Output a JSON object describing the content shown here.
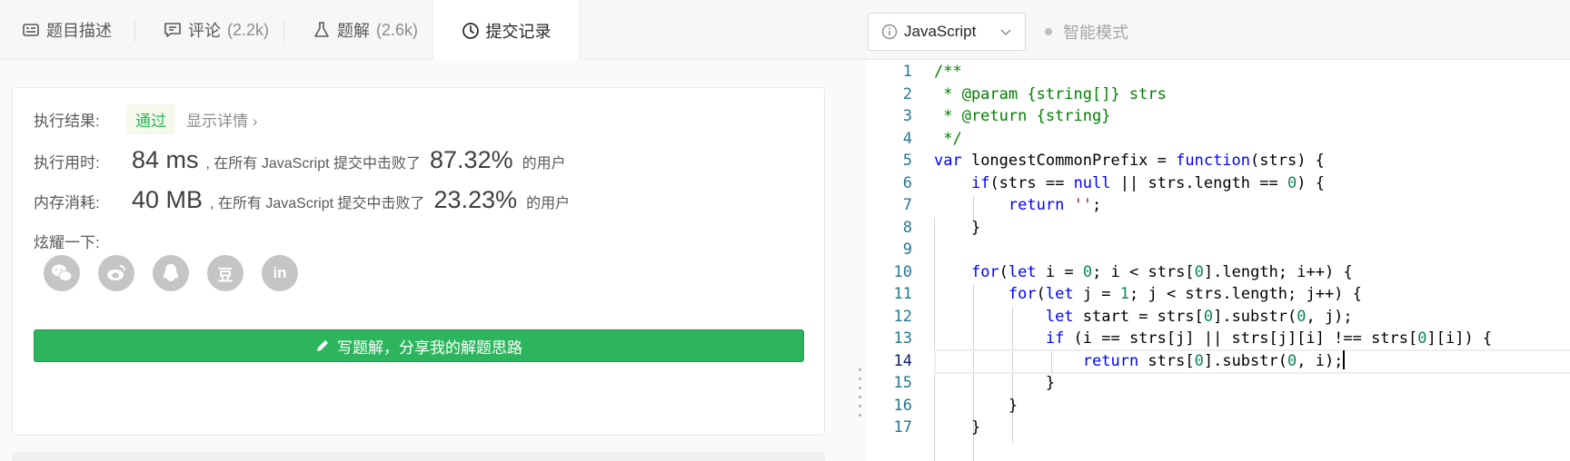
{
  "tabs": [
    {
      "label": "题目描述",
      "count": ""
    },
    {
      "label": "评论",
      "count": "(2.2k)"
    },
    {
      "label": "题解",
      "count": "(2.6k)"
    },
    {
      "label": "提交记录",
      "count": ""
    }
  ],
  "result": {
    "status_label": "执行结果:",
    "status": "通过",
    "details_link": "显示详情",
    "runtime_label": "执行用时:",
    "runtime": "84 ms",
    "runtime_text": ", 在所有 JavaScript 提交中击败了",
    "runtime_pct": "87.32%",
    "users_suffix": "的用户",
    "memory_label": "内存消耗:",
    "memory": "40 MB",
    "memory_text": ", 在所有 JavaScript 提交中击败了",
    "memory_pct": "23.23%",
    "share_label": "炫耀一下:",
    "share_buttons": [
      "wechat",
      "weibo",
      "qq",
      "douban",
      "linkedin"
    ],
    "douban_glyph": "豆",
    "linkedin_glyph": "in",
    "write_button": "写题解，分享我的解题思路"
  },
  "editor": {
    "language": "JavaScript",
    "smart_mode": "智能模式",
    "current_line": 14,
    "line_numbers": [
      "1",
      "2",
      "3",
      "4",
      "5",
      "6",
      "7",
      "8",
      "9",
      "10",
      "11",
      "12",
      "13",
      "14",
      "15",
      "16",
      "17"
    ]
  },
  "colors": {
    "accent_green": "#2db55d",
    "line_number": "#237893",
    "keyword": "#0000ff",
    "comment": "#008000",
    "number": "#098658",
    "string": "#a31515"
  }
}
